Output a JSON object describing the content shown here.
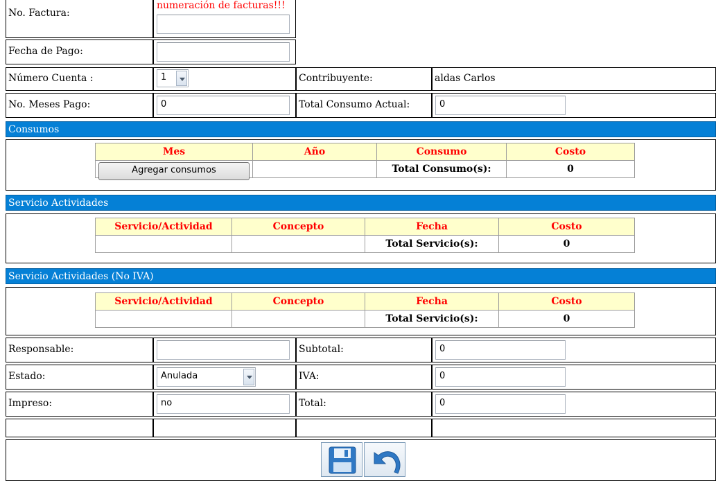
{
  "header": {
    "factura_label": "No. Factura:",
    "factura_warning": "numeración de facturas!!!",
    "factura_value": "",
    "fecha_pago_label": "Fecha de Pago:",
    "fecha_pago_value": "",
    "numero_cuenta_label": "Número Cuenta :",
    "numero_cuenta_value": "1",
    "contribuyente_label": "Contribuyente:",
    "contribuyente_value": "aldas Carlos",
    "meses_pago_label": "No. Meses Pago:",
    "meses_pago_value": "0",
    "total_consumo_label": "Total Consumo Actual:",
    "total_consumo_value": "0"
  },
  "consumos": {
    "title": "Consumos",
    "columns": [
      "Mes",
      "Año",
      "Consumo",
      "Costo"
    ],
    "add_button": "Agregar consumos",
    "total_label": "Total Consumo(s):",
    "total_value": "0"
  },
  "servicios": {
    "title": "Servicio Actividades",
    "columns": [
      "Servicio/Actividad",
      "Concepto",
      "Fecha",
      "Costo"
    ],
    "total_label": "Total Servicio(s):",
    "total_value": "0"
  },
  "servicios_no_iva": {
    "title": "Servicio Actividades (No IVA)",
    "columns": [
      "Servicio/Actividad",
      "Concepto",
      "Fecha",
      "Costo"
    ],
    "total_label": "Total Servicio(s):",
    "total_value": "0"
  },
  "footer": {
    "responsable_label": "Responsable:",
    "responsable_value": "",
    "estado_label": "Estado:",
    "estado_value": "Anulada",
    "impreso_label": "Impreso:",
    "impreso_value": "no",
    "subtotal_label": "Subtotal:",
    "subtotal_value": "0",
    "iva_label": "IVA:",
    "iva_value": "0",
    "total_label": "Total:",
    "total_value": "0"
  },
  "actions": {
    "save_icon": "save-icon",
    "undo_icon": "undo-icon",
    "icon_color": "#1e6fb8"
  }
}
